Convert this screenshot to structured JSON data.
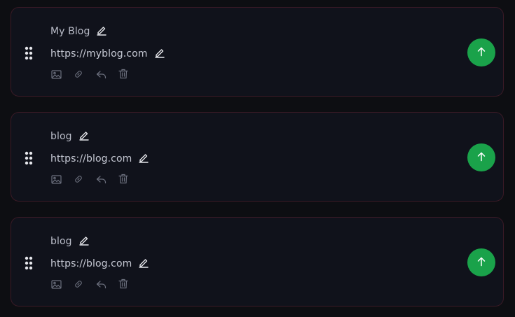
{
  "links": [
    {
      "title": "My Blog",
      "url": "https://myblog.com"
    },
    {
      "title": "blog",
      "url": "https://blog.com"
    },
    {
      "title": "blog",
      "url": "https://blog.com"
    }
  ],
  "icons": {
    "drag": "drag-dots-icon",
    "edit": "pencil-icon",
    "image": "image-icon",
    "link": "link-icon",
    "reply": "reply-arrow-icon",
    "delete": "trash-icon",
    "up": "arrow-up-icon"
  },
  "colors": {
    "background": "#0d0e12",
    "card": "#10121b",
    "card_border": "#3a1a26",
    "accent_green": "#1aa24a",
    "text": "#c6c9d4",
    "muted_icon": "#6b6f7d"
  }
}
